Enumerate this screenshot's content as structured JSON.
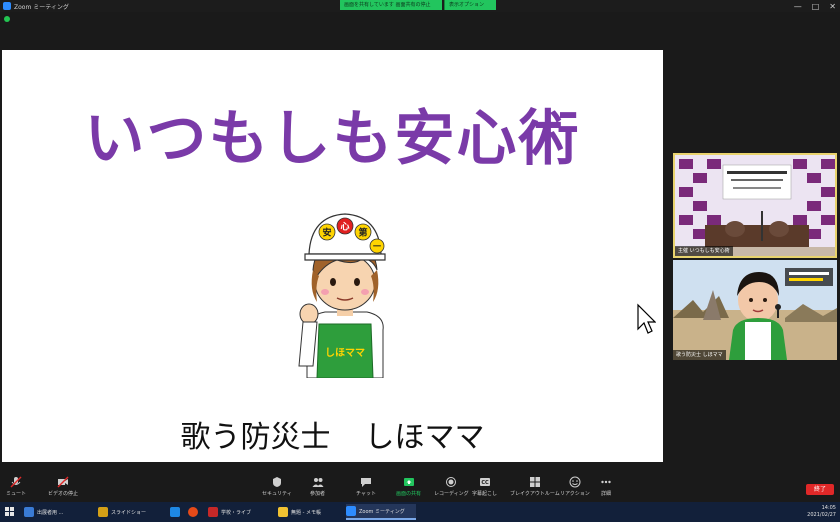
{
  "window": {
    "title": "Zoom ミーティング",
    "share_banner": "画面を共有しています 画面共有の停止",
    "view_options": "表示オプション"
  },
  "slide": {
    "title": "いつもしも安心術",
    "subtitle_left": "歌う防災士",
    "subtitle_right": "しほママ",
    "helmet_chars": [
      "安",
      "心",
      "第",
      "一"
    ],
    "apron_text": "しほママ"
  },
  "participants": [
    {
      "name": "主催 いつもしも安心術"
    },
    {
      "name": "歌う防災士 しほママ"
    }
  ],
  "toolbar": {
    "items": [
      {
        "id": "mute",
        "label": "ミュート"
      },
      {
        "id": "video",
        "label": "ビデオの停止"
      },
      {
        "id": "security",
        "label": "セキュリティ"
      },
      {
        "id": "participants",
        "label": "参加者"
      },
      {
        "id": "chat",
        "label": "チャット"
      },
      {
        "id": "share",
        "label": "画面の共有"
      },
      {
        "id": "record",
        "label": "レコーディング"
      },
      {
        "id": "caption",
        "label": "字幕起こし"
      },
      {
        "id": "breakout",
        "label": "ブレイクアウトルーム"
      },
      {
        "id": "reactions",
        "label": "リアクション"
      },
      {
        "id": "more",
        "label": "詳細"
      }
    ],
    "end_label": "終了"
  },
  "taskbar": {
    "items": [
      {
        "label": "出展者用 ...",
        "color": "#3a7bd5"
      },
      {
        "label": "スライドショー",
        "color": "#d4a017"
      },
      {
        "label": "",
        "color": "#1e88e5"
      },
      {
        "label": "",
        "color": "#e64a19"
      },
      {
        "label": "学校・ライブ",
        "color": "#c62828"
      },
      {
        "label": "無題 - メモ帳",
        "color": "#f1c232"
      },
      {
        "label": "Zoom ミーティング",
        "color": "#2d8cff"
      }
    ],
    "time": "14:05",
    "date": "2021/02/27"
  },
  "colors": {
    "title_purple": "#7a3aa8",
    "end_red": "#e02828",
    "share_green": "#22c55e"
  }
}
